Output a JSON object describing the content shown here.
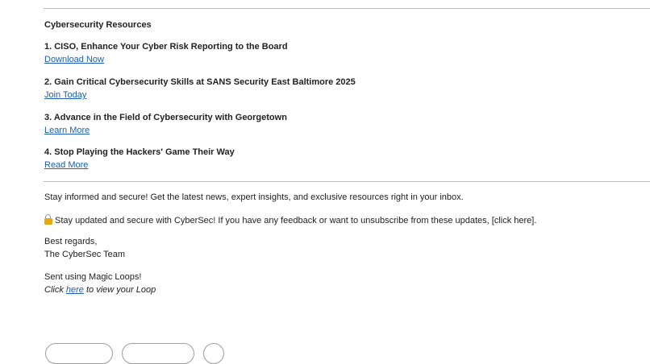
{
  "resources": {
    "heading": "Cybersecurity Resources",
    "items": [
      {
        "title": "1. CISO, Enhance Your Cyber Risk Reporting to the Board",
        "link": "Download Now"
      },
      {
        "title": "2. Gain Critical Cybersecurity Skills at SANS Security East Baltimore 2025",
        "link": "Join Today"
      },
      {
        "title": "3. Advance in the Field of Cybersecurity with Georgetown",
        "link": "Learn More"
      },
      {
        "title": "4. Stop Playing the Hackers' Game Their Way",
        "link": "Read More"
      }
    ]
  },
  "footer": {
    "stay_informed": "Stay informed and secure! Get the latest news, expert insights, and exclusive resources right in your inbox.",
    "updates_notice": "Stay updated and secure with CyberSec! If you have any feedback or want to unsubscribe from these updates, [click here].",
    "regards": "Best regards,",
    "team": "The CyberSec Team",
    "sent_using": "Sent using Magic Loops!",
    "loop_prefix": "Click ",
    "loop_link": "here",
    "loop_suffix": " to view your Loop"
  },
  "icons": {
    "lock": "lock-icon"
  },
  "colors": {
    "link": "#1a5fb4",
    "text": "#222222",
    "divider": "#bdbdbd"
  }
}
